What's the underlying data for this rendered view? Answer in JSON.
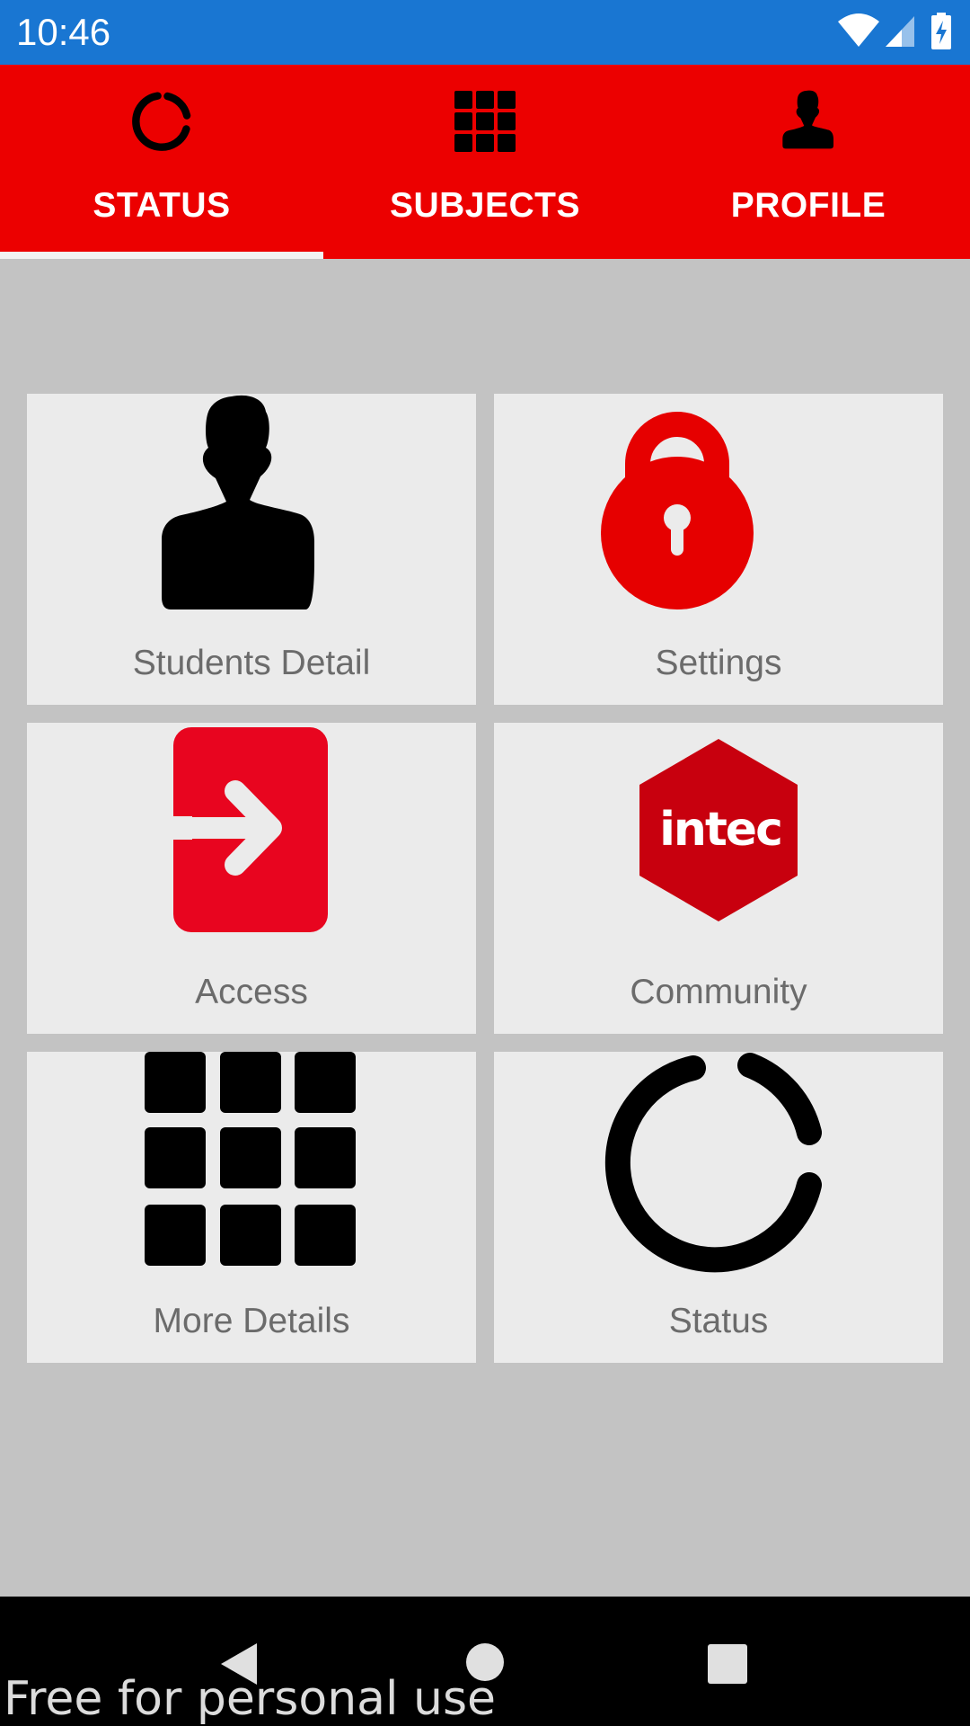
{
  "status_bar": {
    "time": "10:46",
    "icons": [
      "wifi-icon",
      "cell-signal-icon",
      "battery-charging-icon"
    ]
  },
  "tabs": [
    {
      "label": "STATUS",
      "icon": "progress-ring-icon",
      "selected": true
    },
    {
      "label": "SUBJECTS",
      "icon": "grid-icon",
      "selected": false
    },
    {
      "label": "PROFILE",
      "icon": "person-icon",
      "selected": false
    }
  ],
  "cards": [
    {
      "label": "Students Detail",
      "icon": "person-icon"
    },
    {
      "label": "Settings",
      "icon": "lock-icon"
    },
    {
      "label": "Access",
      "icon": "enter-arrow-icon"
    },
    {
      "label": "Community",
      "icon": "intec-logo",
      "logo_text": "intec"
    },
    {
      "label": "More Details",
      "icon": "grid-icon"
    },
    {
      "label": "Status",
      "icon": "progress-ring-icon"
    }
  ],
  "nav_bar": {
    "buttons": [
      "back-icon",
      "home-icon",
      "recents-icon"
    ]
  },
  "watermark": "Free for personal use",
  "colors": {
    "status_bar": "#1976d2",
    "tab_bar": "#ec0000",
    "background": "#c3c3c3",
    "card": "#ebebeb",
    "lock": "#e60000",
    "access": "#e8051f",
    "intec": "#c8000e"
  }
}
